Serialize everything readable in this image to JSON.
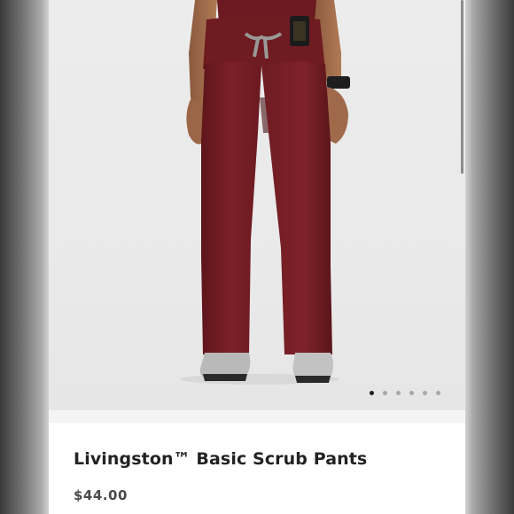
{
  "product": {
    "title": "Livingston™ Basic Scrub Pants",
    "price": "$44.00",
    "image_description_icon": "product-photo",
    "colors": {
      "pants": "#7a1f24",
      "background": "#ececec"
    }
  },
  "carousel": {
    "total_slides": 6,
    "active_index": 0
  }
}
